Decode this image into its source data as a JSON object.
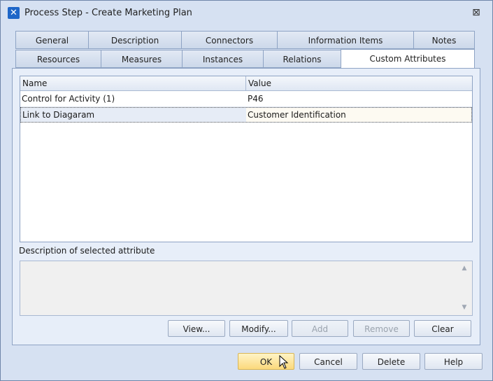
{
  "window": {
    "title": "Process Step - Create Marketing Plan",
    "close_glyph": "⊠"
  },
  "tabs_row1": [
    "General",
    "Description",
    "Connectors",
    "Information Items",
    "Notes"
  ],
  "tabs_row2": [
    "Resources",
    "Measures",
    "Instances",
    "Relations",
    "Custom Attributes"
  ],
  "active_tab": "Custom Attributes",
  "grid": {
    "columns": [
      "Name",
      "Value"
    ],
    "rows": [
      {
        "name": "Control for Activity (1)",
        "value": "P46"
      },
      {
        "name": "Link to Diagaram",
        "value": "Customer Identification"
      }
    ],
    "selected_row": 1
  },
  "description": {
    "label": "Description of selected attribute",
    "text": ""
  },
  "attr_buttons": {
    "view": "View...",
    "modify": "Modify...",
    "add": "Add",
    "remove": "Remove",
    "clear": "Clear"
  },
  "dialog_buttons": {
    "ok": "OK",
    "cancel": "Cancel",
    "delete": "Delete",
    "help": "Help"
  },
  "icons": {
    "app": "process-step-icon",
    "scroll_up": "▲",
    "scroll_down": "▼"
  }
}
